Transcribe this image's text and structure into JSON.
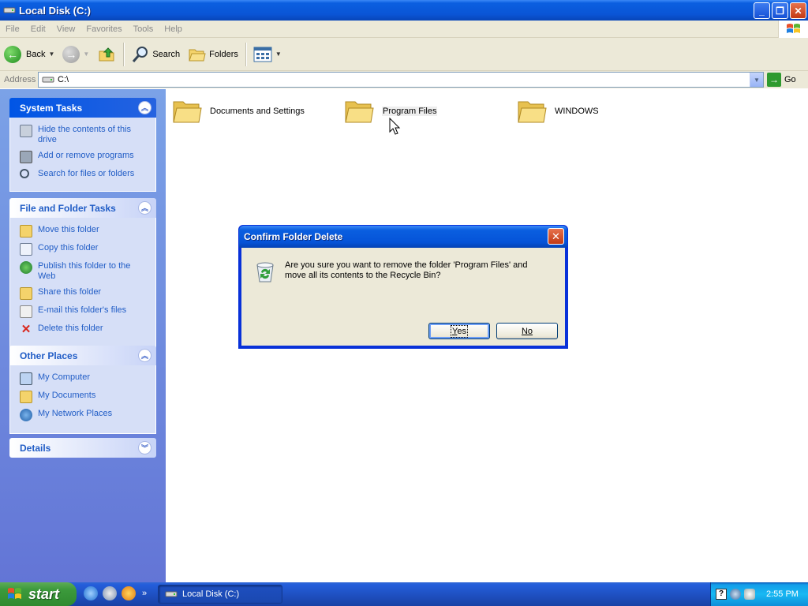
{
  "window": {
    "title": "Local Disk (C:)"
  },
  "menu": [
    "File",
    "Edit",
    "View",
    "Favorites",
    "Tools",
    "Help"
  ],
  "toolbar": {
    "back": "Back",
    "search": "Search",
    "folders": "Folders"
  },
  "address": {
    "label": "Address",
    "value": "C:\\",
    "go": "Go"
  },
  "panels": {
    "system_tasks": {
      "title": "System Tasks",
      "items": [
        "Hide the contents of this drive",
        "Add or remove programs",
        "Search for files or folders"
      ]
    },
    "file_folder_tasks": {
      "title": "File and Folder Tasks",
      "items": [
        "Move this folder",
        "Copy this folder",
        "Publish this folder to the Web",
        "Share this folder",
        "E-mail this folder's files",
        "Delete this folder"
      ]
    },
    "other_places": {
      "title": "Other Places",
      "items": [
        "My Computer",
        "My Documents",
        "My Network Places"
      ]
    },
    "details": {
      "title": "Details"
    }
  },
  "folders": [
    "Documents and Settings",
    "Program Files",
    "WINDOWS"
  ],
  "dialog": {
    "title": "Confirm Folder Delete",
    "message": "Are you sure you want to remove the folder 'Program Files' and move all its contents to the Recycle Bin?",
    "yes": "Yes",
    "no": "No"
  },
  "taskbar": {
    "start": "start",
    "task_item": "Local Disk (C:)",
    "clock": "2:55 PM"
  }
}
